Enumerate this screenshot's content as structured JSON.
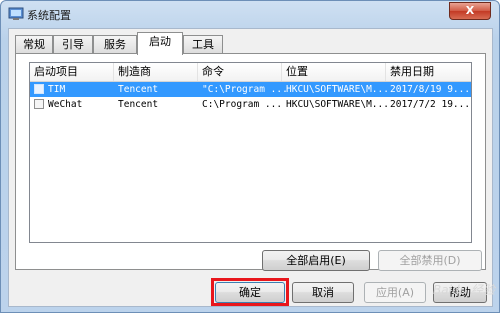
{
  "window": {
    "title": "系统配置",
    "close_label": "X"
  },
  "tabs": [
    {
      "label": "常规"
    },
    {
      "label": "引导"
    },
    {
      "label": "服务"
    },
    {
      "label": "启动"
    },
    {
      "label": "工具"
    }
  ],
  "active_tab": "启动",
  "table": {
    "columns": [
      "启动项目",
      "制造商",
      "命令",
      "位置",
      "禁用日期"
    ],
    "rows": [
      {
        "item": "TIM",
        "maker": "Tencent",
        "command": "\"C:\\Program ...",
        "location": "HKCU\\SOFTWARE\\M...",
        "date": "2017/8/19 9...",
        "selected": true
      },
      {
        "item": "WeChat",
        "maker": "Tencent",
        "command": "C:\\Program ...",
        "location": "HKCU\\SOFTWARE\\M...",
        "date": "2017/7/2 19...",
        "selected": false
      }
    ]
  },
  "panel_buttons": {
    "enable_all": "全部启用(E)",
    "disable_all": "全部禁用(D)"
  },
  "dialog_buttons": {
    "ok": "确定",
    "cancel": "取消",
    "apply": "应用(A)",
    "help": "帮助"
  },
  "watermark": "Baidu 经验",
  "colors": {
    "selection": "#3399ff",
    "highlight_box": "#e8161c"
  }
}
